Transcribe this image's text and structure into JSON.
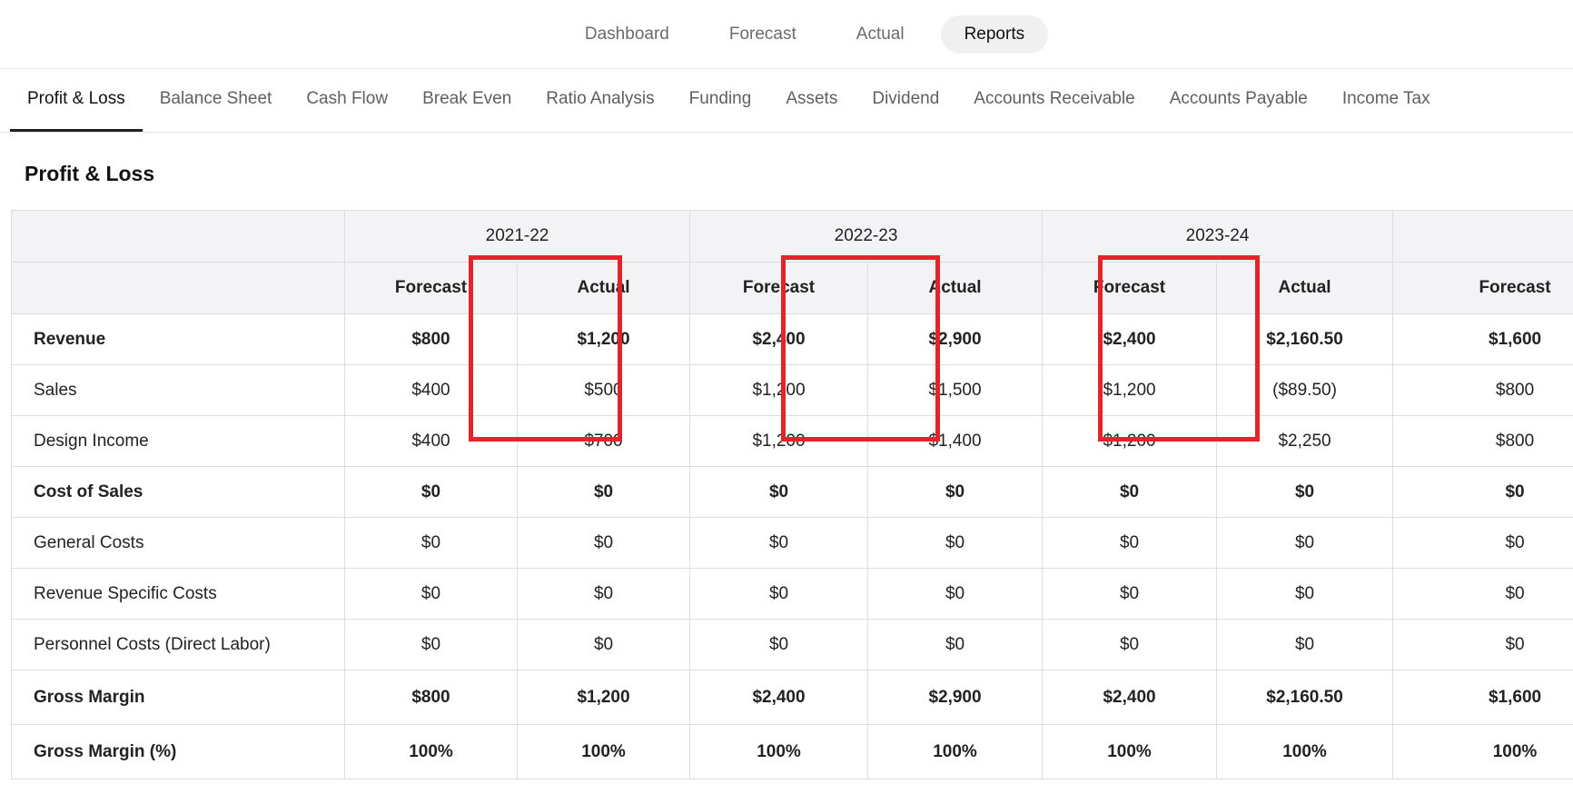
{
  "top_nav": {
    "items": [
      {
        "label": "Dashboard",
        "active": false
      },
      {
        "label": "Forecast",
        "active": false
      },
      {
        "label": "Actual",
        "active": false
      },
      {
        "label": "Reports",
        "active": true
      }
    ]
  },
  "report_tabs": {
    "items": [
      {
        "label": "Profit & Loss",
        "active": true
      },
      {
        "label": "Balance Sheet",
        "active": false
      },
      {
        "label": "Cash Flow",
        "active": false
      },
      {
        "label": "Break Even",
        "active": false
      },
      {
        "label": "Ratio Analysis",
        "active": false
      },
      {
        "label": "Funding",
        "active": false
      },
      {
        "label": "Assets",
        "active": false
      },
      {
        "label": "Dividend",
        "active": false
      },
      {
        "label": "Accounts Receivable",
        "active": false
      },
      {
        "label": "Accounts Payable",
        "active": false
      },
      {
        "label": "Income Tax",
        "active": false
      }
    ]
  },
  "section_title": "Profit & Loss",
  "table": {
    "years": [
      "2021-22",
      "2022-23",
      "2023-24",
      ""
    ],
    "subheaders": [
      "Forecast",
      "Actual",
      "Forecast",
      "Actual",
      "Forecast",
      "Actual",
      "Forecast"
    ],
    "rows": [
      {
        "label": "Revenue",
        "bold": true,
        "values": [
          "$800",
          "$1,200",
          "$2,400",
          "$2,900",
          "$2,400",
          "$2,160.50",
          "$1,600"
        ]
      },
      {
        "label": "Sales",
        "bold": false,
        "values": [
          "$400",
          "$500",
          "$1,200",
          "$1,500",
          "$1,200",
          "($89.50)",
          "$800"
        ]
      },
      {
        "label": "Design Income",
        "bold": false,
        "values": [
          "$400",
          "$700",
          "$1,200",
          "$1,400",
          "$1,200",
          "$2,250",
          "$800"
        ]
      },
      {
        "label": "Cost of Sales",
        "bold": true,
        "values": [
          "$0",
          "$0",
          "$0",
          "$0",
          "$0",
          "$0",
          "$0"
        ]
      },
      {
        "label": "General Costs",
        "bold": false,
        "values": [
          "$0",
          "$0",
          "$0",
          "$0",
          "$0",
          "$0",
          "$0"
        ]
      },
      {
        "label": "Revenue Specific Costs",
        "bold": false,
        "values": [
          "$0",
          "$0",
          "$0",
          "$0",
          "$0",
          "$0",
          "$0"
        ]
      },
      {
        "label": "Personnel Costs (Direct Labor)",
        "bold": false,
        "values": [
          "$0",
          "$0",
          "$0",
          "$0",
          "$0",
          "$0",
          "$0"
        ]
      },
      {
        "label": "Gross Margin",
        "bold": true,
        "values": [
          "$800",
          "$1,200",
          "$2,400",
          "$2,900",
          "$2,400",
          "$2,160.50",
          "$1,600"
        ]
      },
      {
        "label": "Gross Margin (%)",
        "bold": true,
        "values": [
          "100%",
          "100%",
          "100%",
          "100%",
          "100%",
          "100%",
          "100%"
        ]
      }
    ]
  },
  "colors": {
    "highlight": "#e3242b",
    "negative": "#d42a2a",
    "header_bg": "#f3f3f5"
  }
}
